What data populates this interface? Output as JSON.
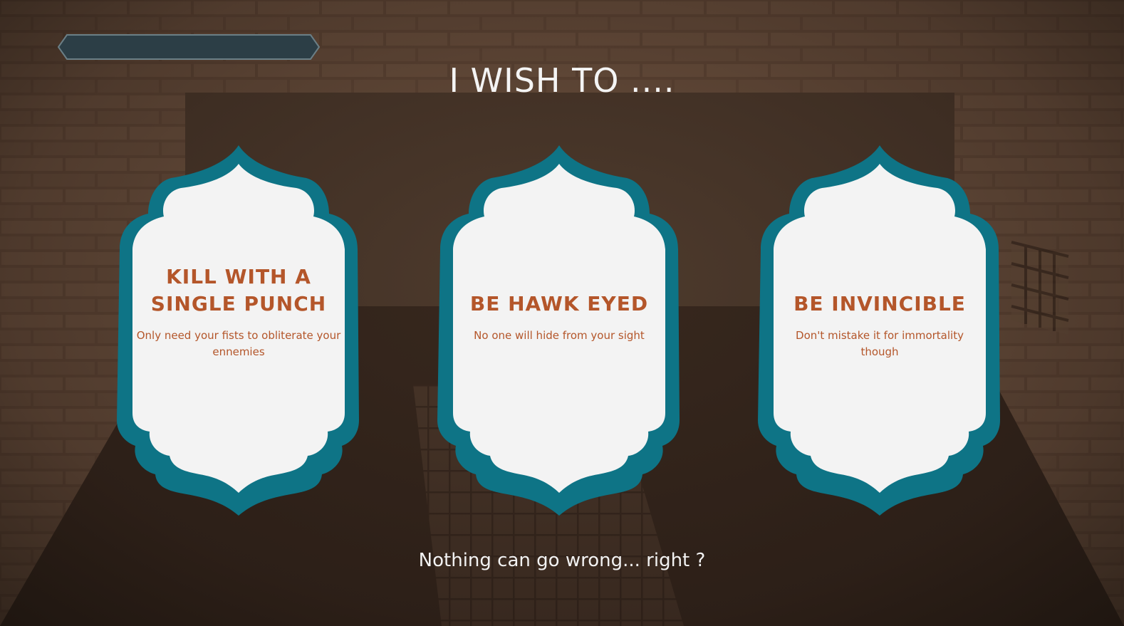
{
  "colors": {
    "card_border": "#0e7486",
    "card_fill": "#f3f3f3",
    "card_text": "#b4562a",
    "title_text": "#f4f4f4",
    "top_bar": "#2c3e46"
  },
  "header": {
    "title": "I WISH TO ...."
  },
  "wishes": [
    {
      "title": "KILL WITH A SINGLE PUNCH",
      "description": "Only need your fists to obliterate your ennemies"
    },
    {
      "title": "BE HAWK EYED",
      "description": "No one will hide from your sight"
    },
    {
      "title": "BE INVINCIBLE",
      "description": "Don't mistake it for immortality though"
    }
  ],
  "footer": {
    "text": "Nothing can go wrong... right ?"
  }
}
